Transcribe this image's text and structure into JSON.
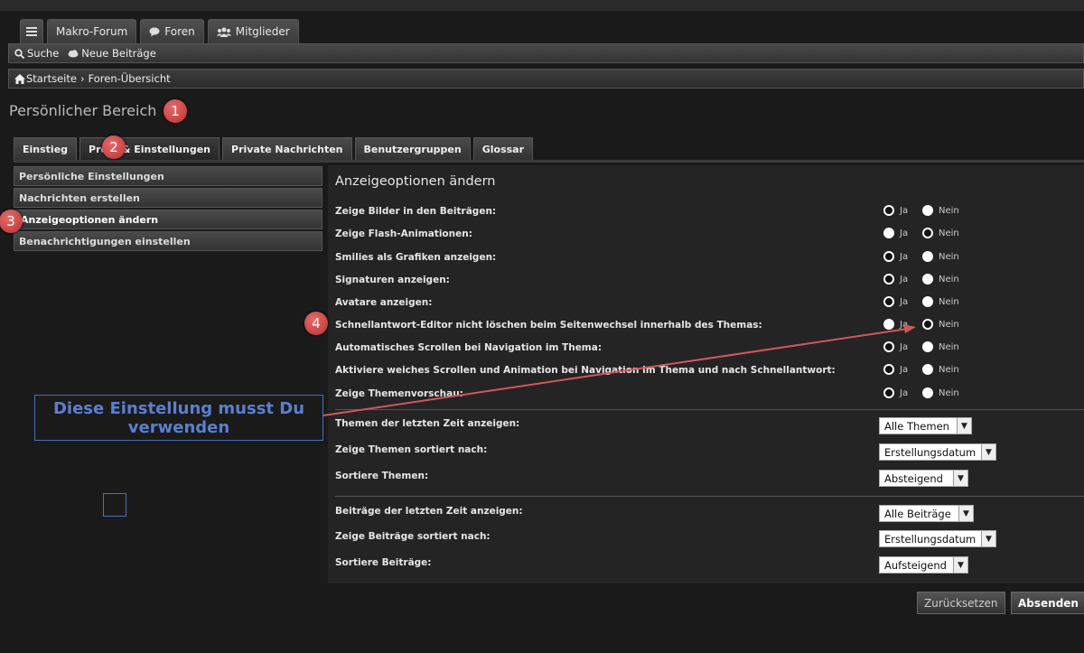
{
  "nav": {
    "tabs": [
      {
        "label": "Makro-Forum",
        "icon": ""
      },
      {
        "label": "Foren",
        "icon": "speech-bubble-icon"
      },
      {
        "label": "Mitglieder",
        "icon": "members-icon"
      }
    ]
  },
  "toolbar": {
    "search": "Suche",
    "new_posts": "Neue Beiträge"
  },
  "breadcrumb": {
    "home": "Startseite",
    "separator": "›",
    "current": "Foren-Übersicht"
  },
  "page_title": "Persönlicher Bereich",
  "sub_tabs": [
    "Einstieg",
    "Profil & Einstellungen",
    "Private Nachrichten",
    "Benutzergruppen",
    "Glossar"
  ],
  "side_menu": [
    "Persönliche Einstellungen",
    "Nachrichten erstellen",
    "Anzeigeoptionen ändern",
    "Benachrichtigungen einstellen"
  ],
  "main": {
    "title": "Anzeigeoptionen ändern",
    "yes_label": "Ja",
    "no_label": "Nein",
    "options": [
      {
        "label": "Zeige Bilder in den Beiträgen:",
        "selected": "Ja"
      },
      {
        "label": "Zeige Flash-Animationen:",
        "selected": "Nein"
      },
      {
        "label": "Smilies als Grafiken anzeigen:",
        "selected": "Ja"
      },
      {
        "label": "Signaturen anzeigen:",
        "selected": "Ja"
      },
      {
        "label": "Avatare anzeigen:",
        "selected": "Ja"
      },
      {
        "label": "Schnellantwort-Editor nicht löschen beim Seitenwechsel innerhalb des Themas:",
        "selected": "Nein"
      },
      {
        "label": "Automatisches Scrollen bei Navigation im Thema:",
        "selected": "Ja"
      },
      {
        "label": "Aktiviere weiches Scrollen und Animation bei Navigation im Thema und nach Schnellantwort:",
        "selected": "Ja"
      },
      {
        "label": "Zeige Themenvorschau:",
        "selected": "Ja"
      }
    ],
    "topic_selects": [
      {
        "label": "Themen der letzten Zeit anzeigen:",
        "value": "Alle Themen"
      },
      {
        "label": "Zeige Themen sortiert nach:",
        "value": "Erstellungsdatum"
      },
      {
        "label": "Sortiere Themen:",
        "value": "Absteigend"
      }
    ],
    "post_selects": [
      {
        "label": "Beiträge der letzten Zeit anzeigen:",
        "value": "Alle Beiträge"
      },
      {
        "label": "Zeige Beiträge sortiert nach:",
        "value": "Erstellungsdatum"
      },
      {
        "label": "Sortiere Beiträge:",
        "value": "Aufsteigend"
      }
    ]
  },
  "buttons": {
    "reset": "Zurücksetzen",
    "submit": "Absenden"
  },
  "annotations": {
    "badges": [
      "1",
      "2",
      "3",
      "4"
    ],
    "callout": "Diese Einstellung musst Du verwenden",
    "badge_color": "#c94444",
    "callout_color": "#4a6fb8"
  }
}
